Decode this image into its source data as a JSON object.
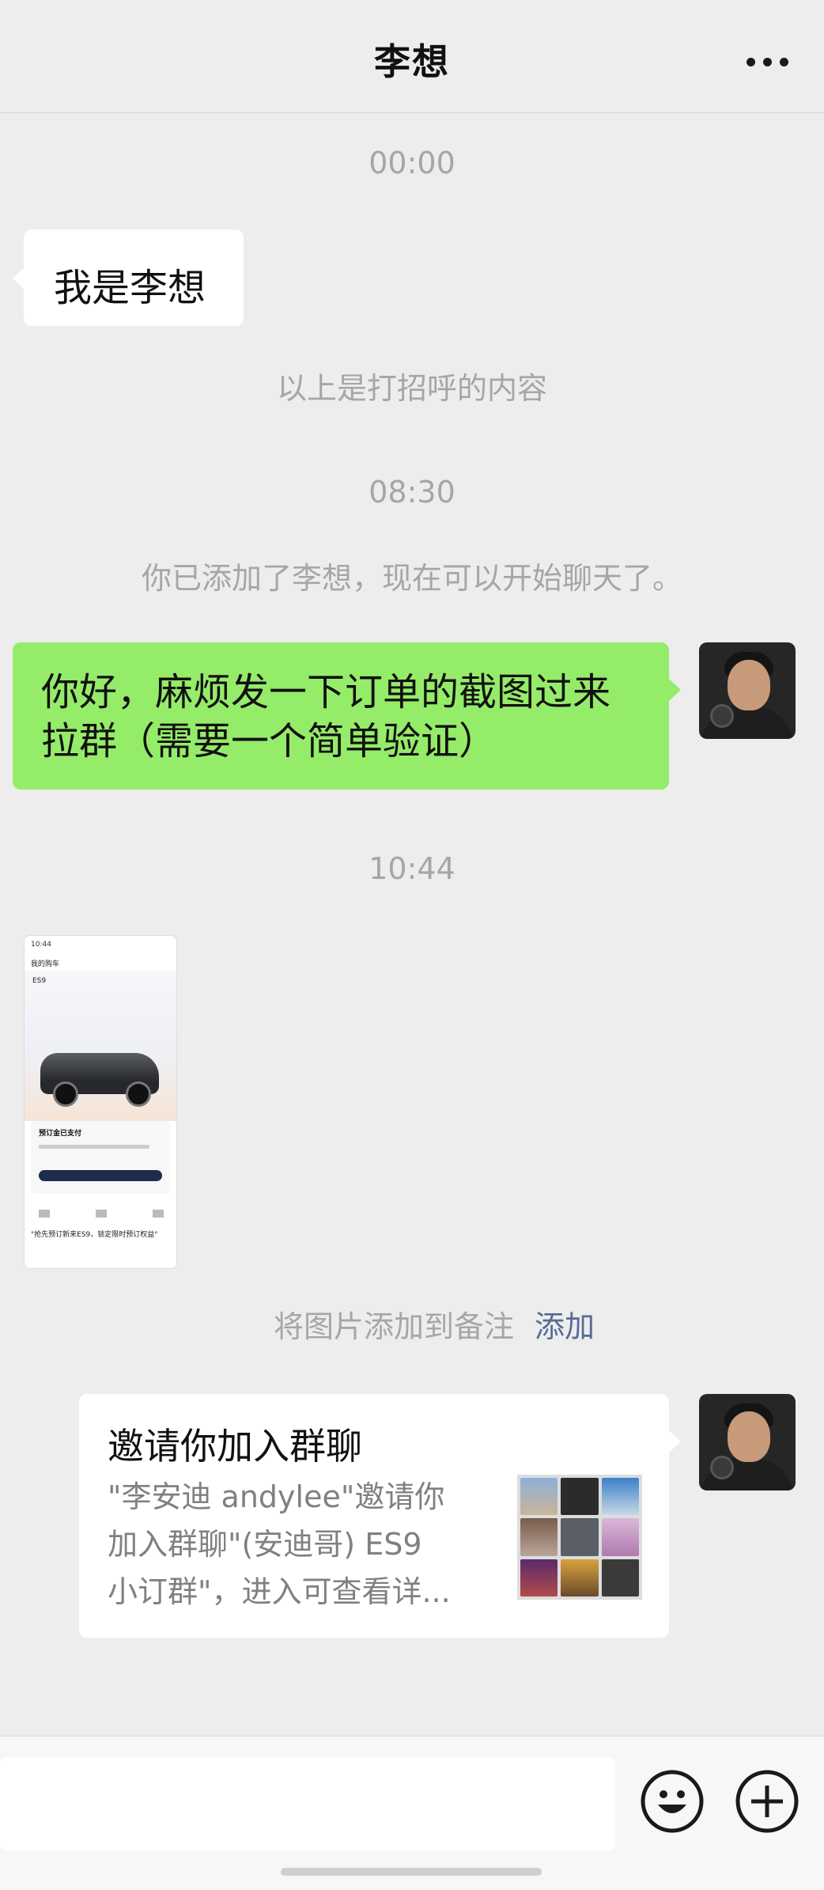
{
  "header": {
    "title": "李想",
    "more_icon": "more-icon"
  },
  "messages": {
    "ts1": "00:00",
    "greeting": "我是李想",
    "greeting_note": "以上是打招呼的内容",
    "ts2": "08:30",
    "added_notice": "你已添加了李想，现在可以开始聊天了。",
    "outgoing_line1": "你好，麻烦发一下订单的截图过来",
    "outgoing_line2": "拉群（需要一个简单验证）",
    "ts3": "10:44",
    "image_note": "将图片添加到备注",
    "image_note_action": "添加"
  },
  "screenshot_thumb": {
    "status_time": "10:44",
    "nav_title": "我的购车",
    "model": "ES9",
    "card_title": "预订金已支付",
    "caption": "\"抢先预订新来ES9，锁定限时预订权益\""
  },
  "share_card": {
    "title": "邀请你加入群聊",
    "desc_line1": "\"李安迪 andylee\"邀请你",
    "desc_line2": "加入群聊\"(安迪哥) ES9",
    "desc_line3": "小订群\"，进入可查看详..."
  },
  "bottom_bar": {
    "emoji_icon": "emoji-icon",
    "plus_icon": "plus-icon"
  },
  "colors": {
    "bg": "#ededed",
    "out_bubble": "#95ec69",
    "link": "#576b95"
  }
}
